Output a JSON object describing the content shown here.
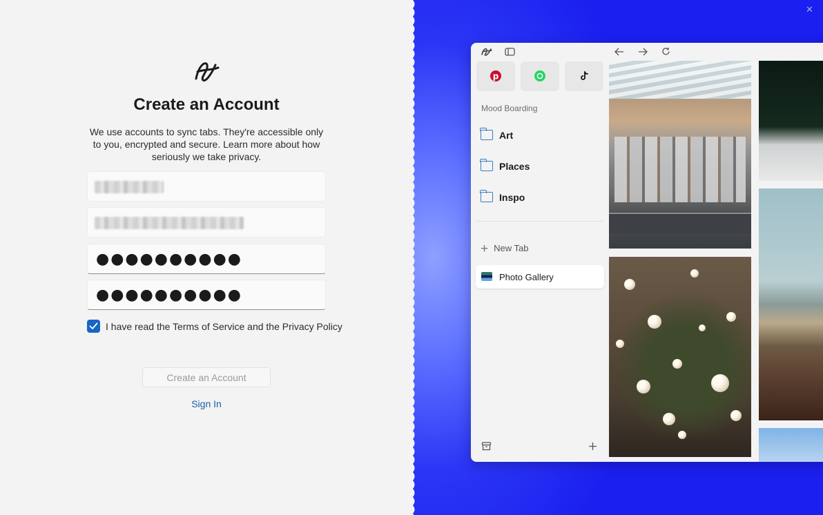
{
  "signup": {
    "title": "Create an Account",
    "description": "We use accounts to sync tabs. They're accessible only to you, encrypted and secure. Learn more about how seriously we take privacy.",
    "password": "●●●●●●●●●●",
    "confirm_password": "●●●●●●●●●●",
    "terms_checked": true,
    "terms_label": "I have read the Terms of Service and the Privacy Policy",
    "create_button": "Create an Account",
    "signin_link": "Sign In"
  },
  "browser": {
    "pinned": [
      {
        "name": "pinterest-icon",
        "color": "#c8102e"
      },
      {
        "name": "whatsapp-icon",
        "color": "#25d366"
      },
      {
        "name": "tiktok-icon",
        "color": "#111111"
      }
    ],
    "section_label": "Mood Boarding",
    "folders": [
      "Art",
      "Places",
      "Inspo"
    ],
    "new_tab_label": "New Tab",
    "active_tab_label": "Photo Gallery"
  },
  "colors": {
    "accent": "#1766c3",
    "link": "#1c5ea8",
    "background_blue": "#1b1fef"
  }
}
